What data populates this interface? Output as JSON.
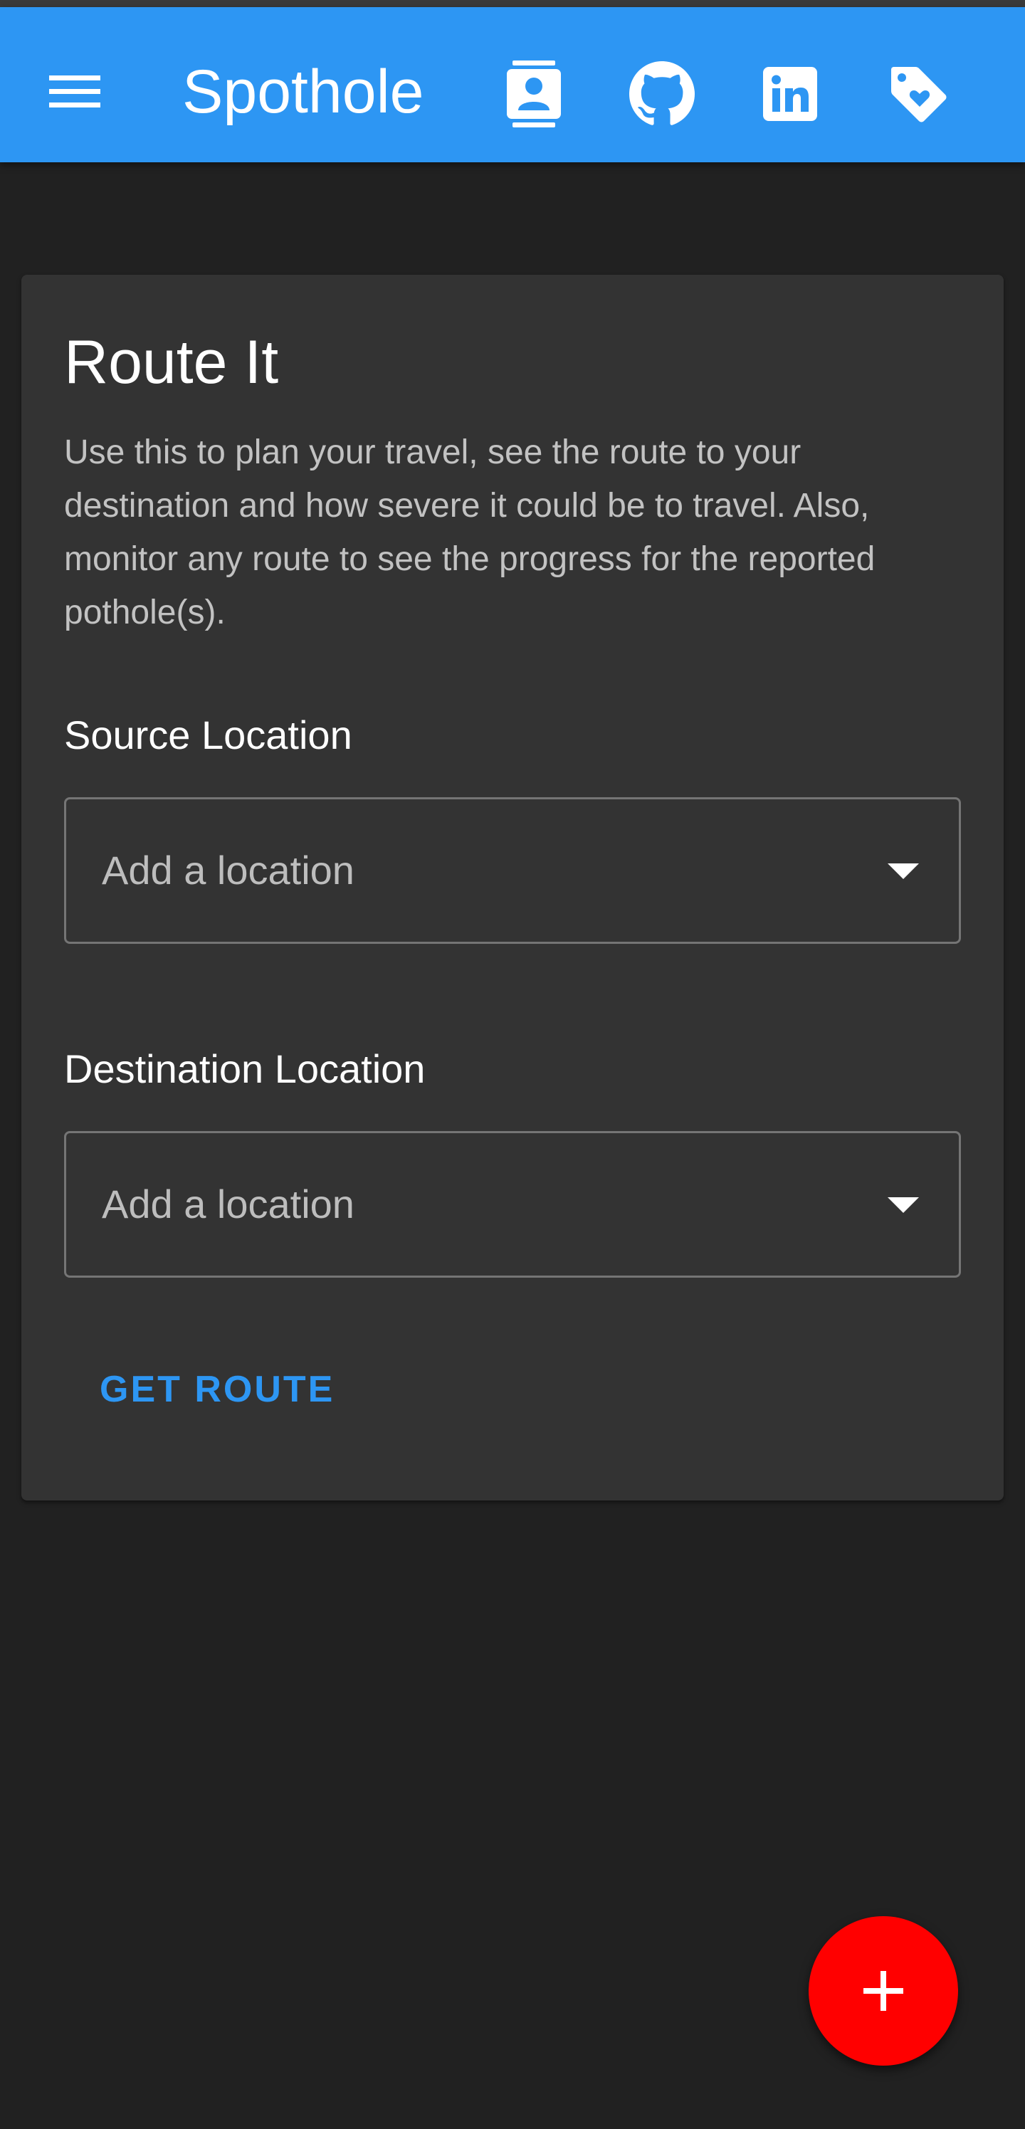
{
  "app_bar": {
    "title": "Spothole",
    "background_color": "#2d96f3",
    "icons": [
      "menu-icon",
      "contacts-icon",
      "github-icon",
      "linkedin-icon",
      "tag-heart-icon"
    ]
  },
  "card": {
    "title": "Route It",
    "description": "Use this to plan your travel, see the route to your destination and how severe it could be to travel. Also, monitor any route to see the progress for the reported pothole(s).",
    "source": {
      "label": "Source Location",
      "placeholder": "Add a location"
    },
    "destination": {
      "label": "Destination Location",
      "placeholder": "Add a location"
    },
    "get_route_label": "GET ROUTE"
  },
  "fab": {
    "icon": "plus-icon",
    "color": "#ff0000"
  }
}
